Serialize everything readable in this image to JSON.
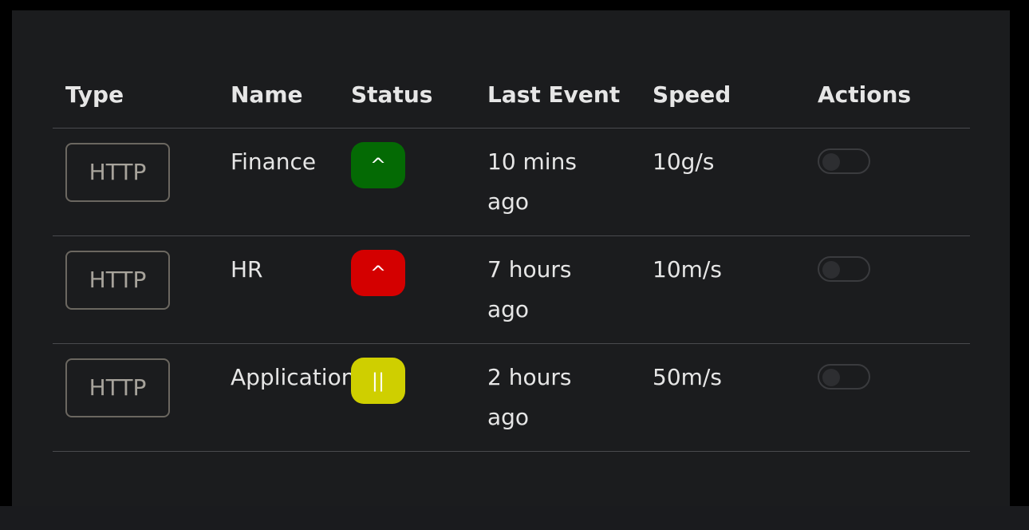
{
  "table": {
    "headers": [
      "Type",
      "Name",
      "Status",
      "Last Event",
      "Speed",
      "Actions"
    ],
    "rows": [
      {
        "type": "HTTP",
        "name": "Finance",
        "status_symbol": "^",
        "status_color": "#046a04",
        "last_event_line1": "10 mins",
        "last_event_line2": "ago",
        "speed": "10g/s",
        "toggle_on": false
      },
      {
        "type": "HTTP",
        "name": "HR",
        "status_symbol": "^",
        "status_color": "#d40000",
        "last_event_line1": "7 hours",
        "last_event_line2": "ago",
        "speed": "10m/s",
        "toggle_on": false
      },
      {
        "type": "HTTP",
        "name": "Application",
        "status_symbol": "||",
        "status_color": "#cfcf00",
        "last_event_line1": "2 hours",
        "last_event_line2": "ago",
        "speed": "50m/s",
        "toggle_on": false
      }
    ]
  },
  "colors": {
    "background": "#000000",
    "panel": "#1b1c1e",
    "text": "#e6e6e6",
    "divider": "#4a4b4e"
  }
}
